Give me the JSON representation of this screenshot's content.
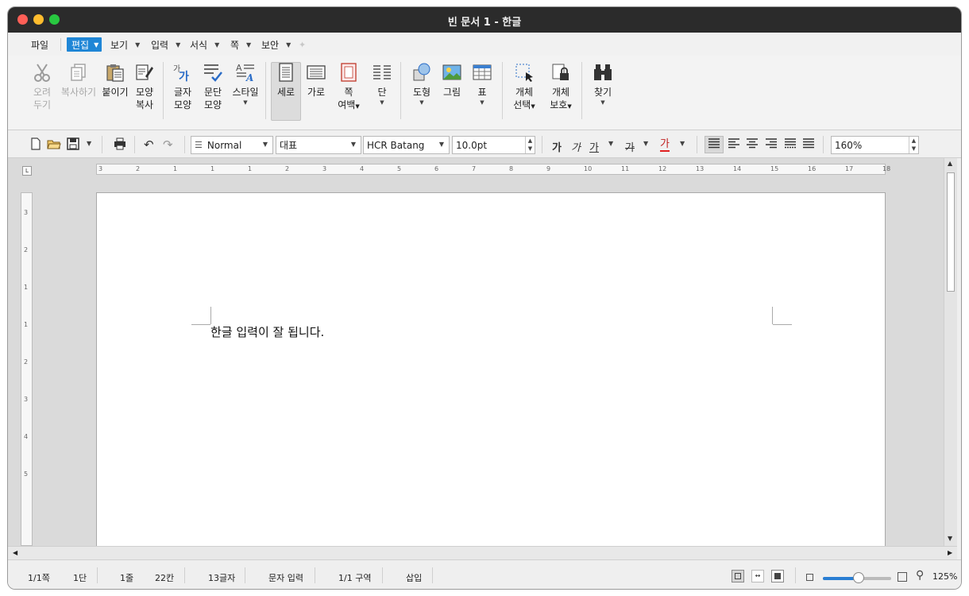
{
  "window": {
    "title": "빈 문서 1 - 한글"
  },
  "menu": {
    "items": [
      "파일",
      "편집",
      "보기",
      "입력",
      "서식",
      "쪽",
      "보안"
    ],
    "active": "편집"
  },
  "ribbon": {
    "cut": [
      "오려",
      "두기"
    ],
    "copy": "복사하기",
    "paste": "붙이기",
    "format_copy": [
      "모양",
      "복사"
    ],
    "char_shape": [
      "글자",
      "모양"
    ],
    "para_shape": [
      "문단",
      "모양"
    ],
    "style": "스타일",
    "portrait": "세로",
    "landscape": "가로",
    "page_margin": [
      "쪽",
      "여백"
    ],
    "columns": "단",
    "shapes": "도형",
    "picture": "그림",
    "table": "표",
    "object_select": [
      "개체",
      "선택"
    ],
    "object_protect": [
      "개체",
      "보호"
    ],
    "find": "찾기"
  },
  "format_bar": {
    "style": "Normal",
    "font_lang": "대표",
    "font": "HCR Batang",
    "size": "10.0pt",
    "bold_glyph": "가",
    "italic_glyph": "가",
    "underline_glyph": "가",
    "strike_glyph": "가",
    "color_glyph": "가",
    "zoom": "160%"
  },
  "ruler": {
    "h_numbers": [
      "3",
      "2",
      "1",
      "1",
      "1",
      "2",
      "3",
      "4",
      "5",
      "6",
      "7",
      "8",
      "9",
      "10",
      "11",
      "12",
      "13",
      "14",
      "15",
      "16",
      "17",
      "18"
    ],
    "v_numbers": [
      "3",
      "2",
      "1",
      "1",
      "2",
      "3",
      "4",
      "5"
    ]
  },
  "document": {
    "text": "한글 입력이 잘 됩니다."
  },
  "status": {
    "page": "1/1쪽",
    "column": "1단",
    "line": "1줄",
    "col": "22칸",
    "chars": "13글자",
    "mode": "문자 입력",
    "section": "1/1 구역",
    "insert": "삽입",
    "zoom": "125%",
    "zoom_level": 0.52
  },
  "colors": {
    "accent": "#1f86d6",
    "titlebar": "#2b2b2b",
    "font_color_bar": "#e02020"
  }
}
